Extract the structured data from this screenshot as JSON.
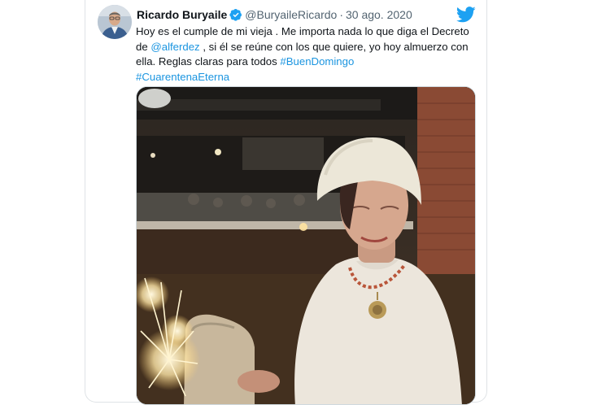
{
  "tweet": {
    "display_name": "Ricardo Buryaile",
    "handle": "@BuryaileRicardo",
    "separator": "·",
    "date": "30 ago. 2020",
    "text_1": "Hoy es el cumple de mi vieja . Me importa nada lo que diga el Decreto de ",
    "mention": "@alferdez",
    "text_2": " , si él se reúne con los que quiere, yo hoy almuerzo con ella. Reglas claras para todos ",
    "hashtag_1": "#BuenDomingo",
    "hashtag_2": "#CuarentenaEterna"
  },
  "icons": {
    "verified": "verified-badge-icon",
    "brand": "twitter-bird-icon"
  },
  "colors": {
    "link": "#1b95e0",
    "verified": "#1da1f2",
    "brand": "#1da1f2",
    "text": "#0f1419",
    "secondary": "#536471"
  }
}
